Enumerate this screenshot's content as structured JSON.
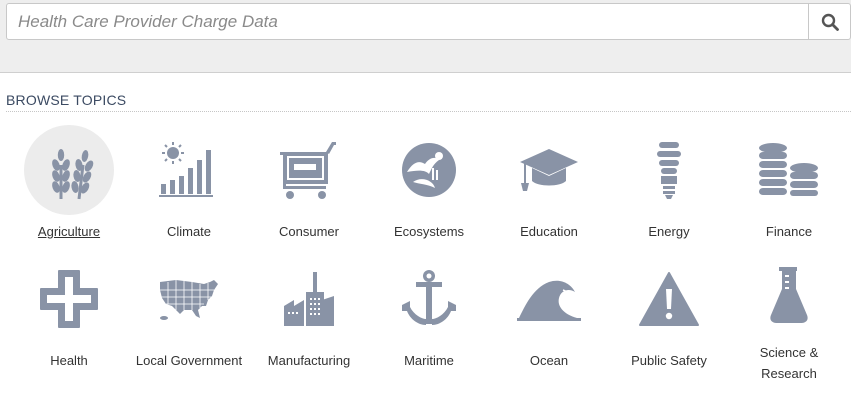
{
  "search": {
    "placeholder": "Health Care Provider Charge Data",
    "button_icon": "search-icon"
  },
  "browse": {
    "heading": "BROWSE TOPICS"
  },
  "colors": {
    "icon": "#8993a6",
    "heading": "#3b4a62",
    "active_bg": "#ececec"
  },
  "topics": [
    {
      "label": "Agriculture",
      "icon": "wheat-icon",
      "active": true
    },
    {
      "label": "Climate",
      "icon": "sun-bar-chart-icon",
      "active": false
    },
    {
      "label": "Consumer",
      "icon": "shopping-cart-icon",
      "active": false
    },
    {
      "label": "Ecosystems",
      "icon": "ecosystem-icon",
      "active": false
    },
    {
      "label": "Education",
      "icon": "graduation-cap-icon",
      "active": false
    },
    {
      "label": "Energy",
      "icon": "light-bulb-icon",
      "active": false
    },
    {
      "label": "Finance",
      "icon": "coin-stacks-icon",
      "active": false
    },
    {
      "label": "Health",
      "icon": "health-cross-icon",
      "active": false
    },
    {
      "label": "Local Government",
      "icon": "us-map-icon",
      "active": false
    },
    {
      "label": "Manufacturing",
      "icon": "factory-icon",
      "active": false
    },
    {
      "label": "Maritime",
      "icon": "anchor-icon",
      "active": false
    },
    {
      "label": "Ocean",
      "icon": "wave-icon",
      "active": false
    },
    {
      "label": "Public Safety",
      "icon": "warning-icon",
      "active": false
    },
    {
      "label": "Science & Research",
      "icon": "flask-icon",
      "active": false
    }
  ]
}
